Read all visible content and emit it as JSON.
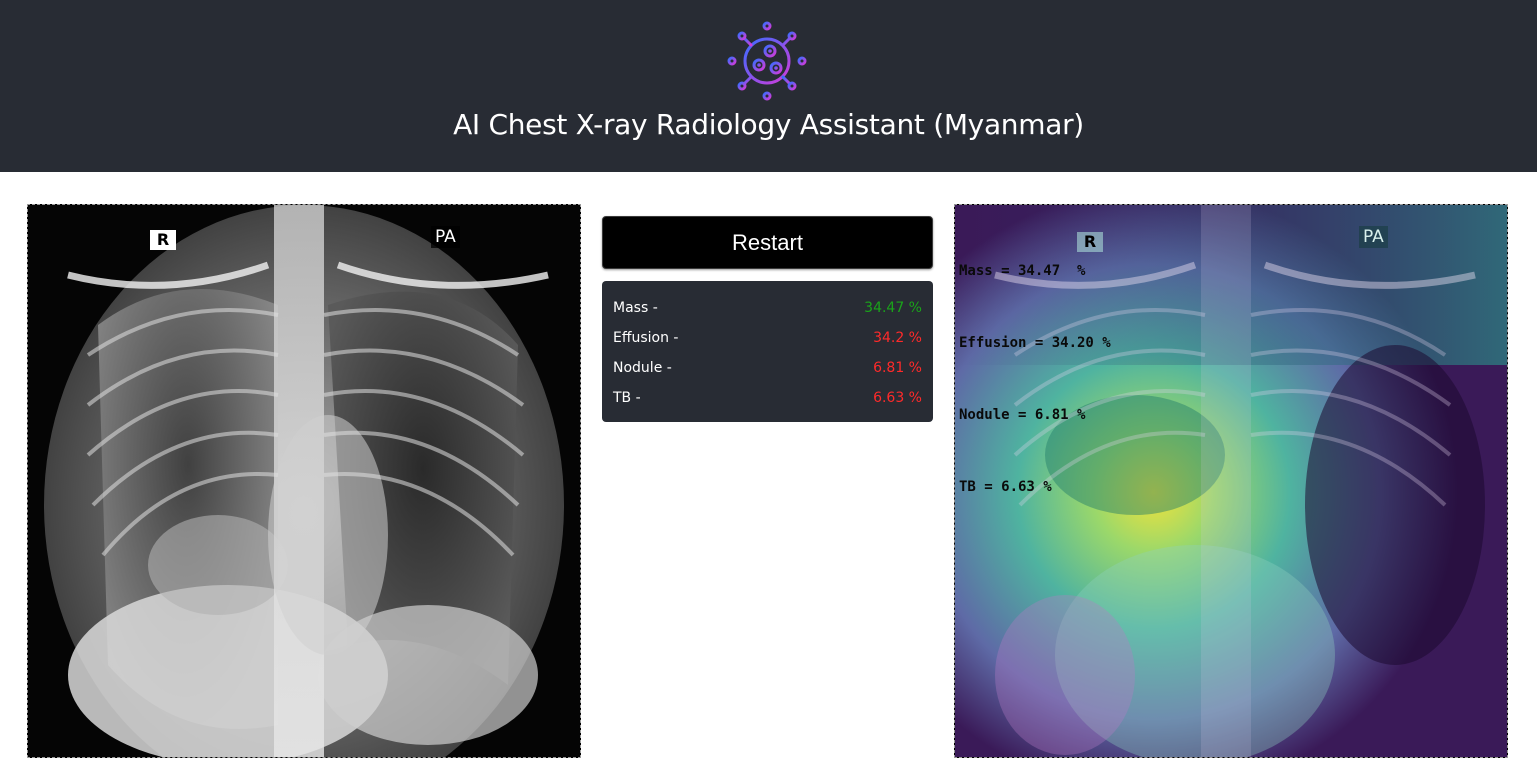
{
  "header": {
    "title": "AI Chest X-ray Radiology Assistant (Myanmar)",
    "logo_icon": "virus-icon",
    "background": "#282c34"
  },
  "left_image": {
    "marker_r": "R",
    "marker_pa": "PA"
  },
  "controls": {
    "restart_label": "Restart"
  },
  "results": [
    {
      "label": "Mass -",
      "value": "34.47 %",
      "status_color": "#1aa31a"
    },
    {
      "label": "Effusion -",
      "value": "34.2 %",
      "status_color": "#ff2a2a"
    },
    {
      "label": "Nodule -",
      "value": "6.81 %",
      "status_color": "#ff2a2a"
    },
    {
      "label": "TB -",
      "value": "6.63 %",
      "status_color": "#ff2a2a"
    }
  ],
  "heatmap_image": {
    "marker_r": "R",
    "marker_pa": "PA",
    "overlay_lines": [
      "Mass = 34.47  %",
      "Effusion = 34.20 %",
      "Nodule = 6.81 %",
      "TB = 6.63 %"
    ]
  }
}
